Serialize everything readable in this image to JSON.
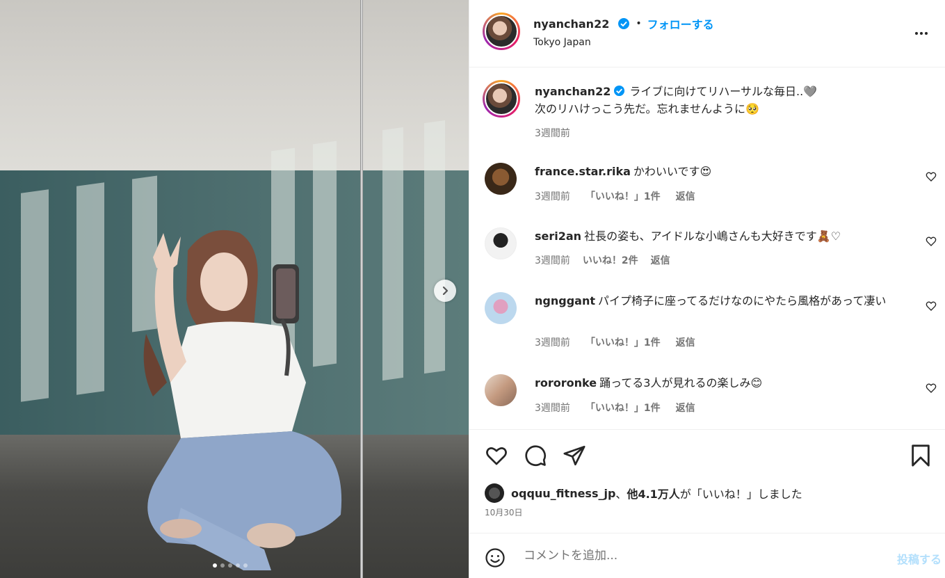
{
  "post": {
    "username": "nyanchan22",
    "separator": "•",
    "follow_label": "フォローする",
    "location": "Tokyo Japan",
    "caption_line1": "ライブに向けてリハーサルな毎日..🩶",
    "caption_line2": "次のリハけっこう先だ。忘れませんように🥺",
    "caption_time": "3週間前"
  },
  "comments": [
    {
      "user": "france.star.rika",
      "text": "かわいいです😍",
      "time": "3週間前",
      "likes": "「いいね！」1件",
      "reply": "返信"
    },
    {
      "user": "seri2an",
      "text": "社長の姿も、アイドルな小嶋さんも大好きです🧸♡",
      "time": "3週間前",
      "likes": "いいね！2件",
      "reply": "返信"
    },
    {
      "user": "ngnggant",
      "text": "パイプ椅子に座ってるだけなのにやたら風格があって凄い",
      "time": "3週間前",
      "likes": "「いいね！」1件",
      "reply": "返信"
    },
    {
      "user": "rororonke",
      "text": "踊ってる3人が見れるの楽しみ😊",
      "time": "3週間前",
      "likes": "「いいね！」1件",
      "reply": "返信"
    }
  ],
  "likes": {
    "first_user": "oqquu_fitness_jp",
    "joiner": "、",
    "others": "他4.1万人",
    "suffix": "が「いいね！」しました"
  },
  "date": "10月30日",
  "composer": {
    "placeholder": "コメントを追加...",
    "post_label": "投稿する"
  },
  "carousel": {
    "count": 5,
    "active_index": 0
  },
  "colors": {
    "accent": "#0095f6",
    "verified": "#0095f6",
    "muted": "#737373"
  }
}
